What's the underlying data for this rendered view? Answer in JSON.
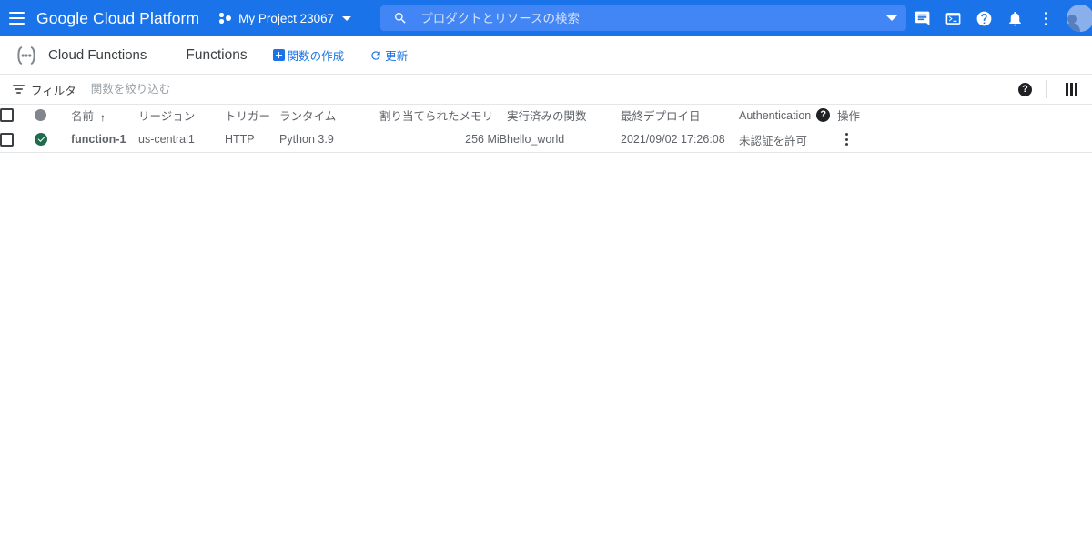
{
  "appbar": {
    "menu_icon": "hamburger-menu-icon",
    "brand": "Google Cloud Platform",
    "project": {
      "icon": "project-dots-icon",
      "name": "My Project 23067",
      "caret": "chevron-down-icon"
    },
    "search": {
      "icon": "search-icon",
      "placeholder": "プロダクトとリソースの検索",
      "value": "",
      "expand_icon": "chevron-down-icon"
    },
    "actions": [
      {
        "name": "feedback-icon",
        "label": "フィードバック"
      },
      {
        "name": "cloud-shell-icon",
        "label": "Cloud Shell"
      },
      {
        "name": "help-icon",
        "label": "ヘルプ"
      },
      {
        "name": "notifications-icon",
        "label": "通知"
      },
      {
        "name": "more-options-icon",
        "label": "その他のオプション"
      }
    ],
    "avatar": "account-avatar",
    "colors": {
      "bar": "#1a73e8",
      "search_bg": "#4285f4"
    }
  },
  "subheader": {
    "logo": "cloud-functions-logo",
    "product": "Cloud Functions",
    "title": "Functions",
    "create_label": "関数の作成",
    "refresh_label": "更新",
    "refresh_icon": "refresh-icon",
    "link_color": "#1a73e8"
  },
  "filterbar": {
    "filter_icon": "filter-icon",
    "filter_label": "フィルタ",
    "input_placeholder": "関数を絞り込む",
    "input_value": "",
    "help_icon": "help-icon",
    "columns_icon": "column-display-icon"
  },
  "table": {
    "columns": {
      "name": "名前",
      "region": "リージョン",
      "trigger": "トリガー",
      "runtime": "ランタイム",
      "memory": "割り当てられたメモリ",
      "exec_fn": "実行済みの関数",
      "last_deploy": "最終デプロイ日",
      "authentication": "Authentication",
      "operations": "操作"
    },
    "sort": {
      "column": "名前",
      "direction_glyph": "↑"
    },
    "rows": [
      {
        "status": "ok",
        "name": "function-1",
        "region": "us-central1",
        "trigger": "HTTP",
        "runtime": "Python 3.9",
        "memory": "256 MiB",
        "exec_fn": "hello_world",
        "last_deploy": "2021/09/02 17:26:08",
        "authentication": "未認証を許可",
        "menu_icon": "row-more-icon"
      }
    ],
    "status_colors": {
      "ok": "#1e6b4e",
      "header_dot": "#80868b"
    }
  }
}
